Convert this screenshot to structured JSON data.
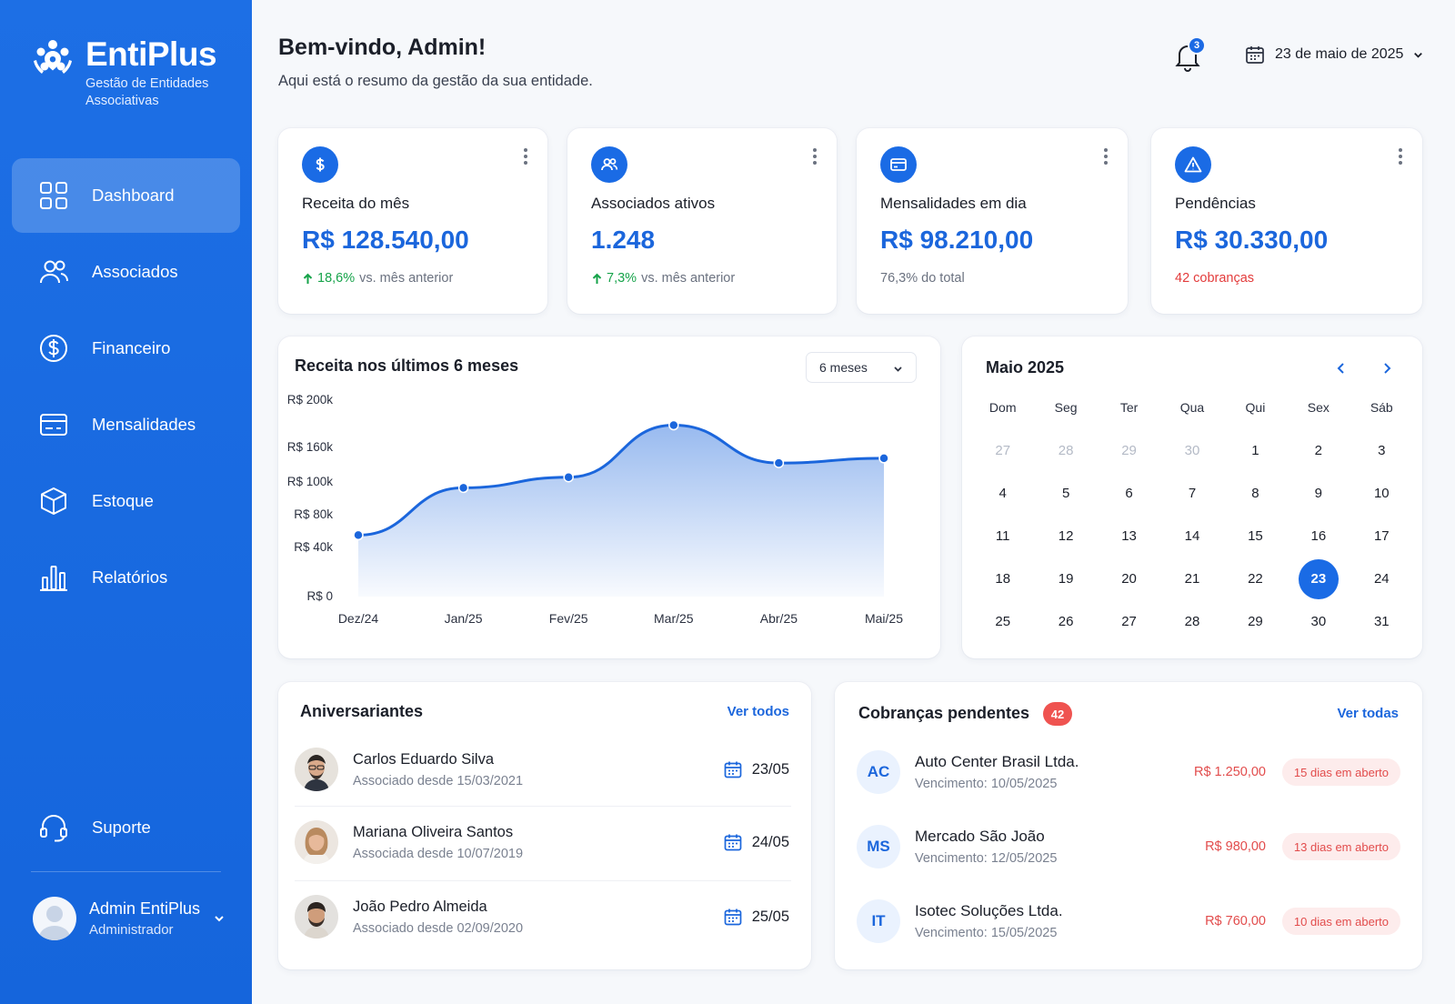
{
  "brand": {
    "name": "EntiPlus",
    "subtitle": "Gestão de Entidades Associativas"
  },
  "sidebar": {
    "items": [
      {
        "label": "Dashboard",
        "icon": "grid-icon",
        "active": true
      },
      {
        "label": "Associados",
        "icon": "users-icon"
      },
      {
        "label": "Financeiro",
        "icon": "dollar-circle-icon"
      },
      {
        "label": "Mensalidades",
        "icon": "card-icon"
      },
      {
        "label": "Estoque",
        "icon": "box-icon"
      },
      {
        "label": "Relatórios",
        "icon": "bar-chart-icon"
      }
    ],
    "support_label": "Suporte",
    "user": {
      "name": "Admin EntiPlus",
      "role": "Administrador"
    }
  },
  "header": {
    "title": "Bem-vindo, Admin!",
    "subtitle": "Aqui está o resumo da gestão da sua entidade.",
    "notifications": "3",
    "date": "23 de maio de 2025"
  },
  "kpis": [
    {
      "label": "Receita do mês",
      "value": "R$ 128.540,00",
      "trend": "18,6%",
      "foot": "vs. mês anterior",
      "icon": "dollar-icon"
    },
    {
      "label": "Associados ativos",
      "value": "1.248",
      "trend": "7,3%",
      "foot": "vs. mês anterior",
      "icon": "users-icon"
    },
    {
      "label": "Mensalidades em dia",
      "value": "R$ 98.210,00",
      "foot": "76,3% do total",
      "icon": "card-icon"
    },
    {
      "label": "Pendências",
      "value": "R$ 30.330,00",
      "foot": "42 cobranças",
      "icon": "warning-icon"
    }
  ],
  "chart_data": {
    "type": "area",
    "title": "Receita nos últimos 6 meses",
    "period_select": "6 meses",
    "categories": [
      "Dez/24",
      "Jan/25",
      "Fev/25",
      "Mar/25",
      "Abr/25",
      "Mai/25"
    ],
    "y_ticks": [
      "R$ 200k",
      "R$ 160k",
      "R$ 100k",
      "R$ 80k",
      "R$ 40k",
      "R$ 0"
    ],
    "series": [
      {
        "values": [
          52,
          92,
          101,
          145,
          113,
          117
        ]
      }
    ],
    "ylim": [
      0,
      160
    ],
    "color": "#1b66dc",
    "grid": false
  },
  "calendar": {
    "title": "Maio 2025",
    "weekdays": [
      "Dom",
      "Seg",
      "Ter",
      "Qua",
      "Qui",
      "Sex",
      "Sáb"
    ],
    "days": [
      [
        "27",
        "muted"
      ],
      [
        "28",
        "muted"
      ],
      [
        "29",
        "muted"
      ],
      [
        "30",
        "muted"
      ],
      [
        "1",
        ""
      ],
      [
        "2",
        ""
      ],
      [
        "3",
        ""
      ],
      [
        "4",
        ""
      ],
      [
        "5",
        ""
      ],
      [
        "6",
        ""
      ],
      [
        "7",
        ""
      ],
      [
        "8",
        ""
      ],
      [
        "9",
        ""
      ],
      [
        "10",
        ""
      ],
      [
        "11",
        ""
      ],
      [
        "12",
        ""
      ],
      [
        "13",
        ""
      ],
      [
        "14",
        ""
      ],
      [
        "15",
        ""
      ],
      [
        "16",
        ""
      ],
      [
        "17",
        ""
      ],
      [
        "18",
        ""
      ],
      [
        "19",
        ""
      ],
      [
        "20",
        ""
      ],
      [
        "21",
        ""
      ],
      [
        "22",
        ""
      ],
      [
        "23",
        "selected"
      ],
      [
        "24",
        ""
      ],
      [
        "25",
        ""
      ],
      [
        "26",
        ""
      ],
      [
        "27",
        ""
      ],
      [
        "28",
        ""
      ],
      [
        "29",
        ""
      ],
      [
        "30",
        ""
      ],
      [
        "31",
        ""
      ]
    ]
  },
  "birthdays": {
    "title": "Aniversariantes",
    "link": "Ver todos",
    "items": [
      {
        "name": "Carlos Eduardo Silva",
        "since": "Associado desde 15/03/2021",
        "date": "23/05"
      },
      {
        "name": "Mariana Oliveira Santos",
        "since": "Associada desde 10/07/2019",
        "date": "24/05"
      },
      {
        "name": "João Pedro Almeida",
        "since": "Associado desde 02/09/2020",
        "date": "25/05"
      }
    ]
  },
  "charges": {
    "title": "Cobranças pendentes",
    "count": "42",
    "link": "Ver todas",
    "items": [
      {
        "initials": "AC",
        "name": "Auto Center Brasil Ltda.",
        "due": "Vencimento: 10/05/2025",
        "amount": "R$ 1.250,00",
        "status": "15 dias em aberto"
      },
      {
        "initials": "MS",
        "name": "Mercado São João",
        "due": "Vencimento: 12/05/2025",
        "amount": "R$ 980,00",
        "status": "13 dias em aberto"
      },
      {
        "initials": "IT",
        "name": "Isotec Soluções Ltda.",
        "due": "Vencimento: 15/05/2025",
        "amount": "R$ 760,00",
        "status": "10 dias em aberto"
      }
    ]
  }
}
